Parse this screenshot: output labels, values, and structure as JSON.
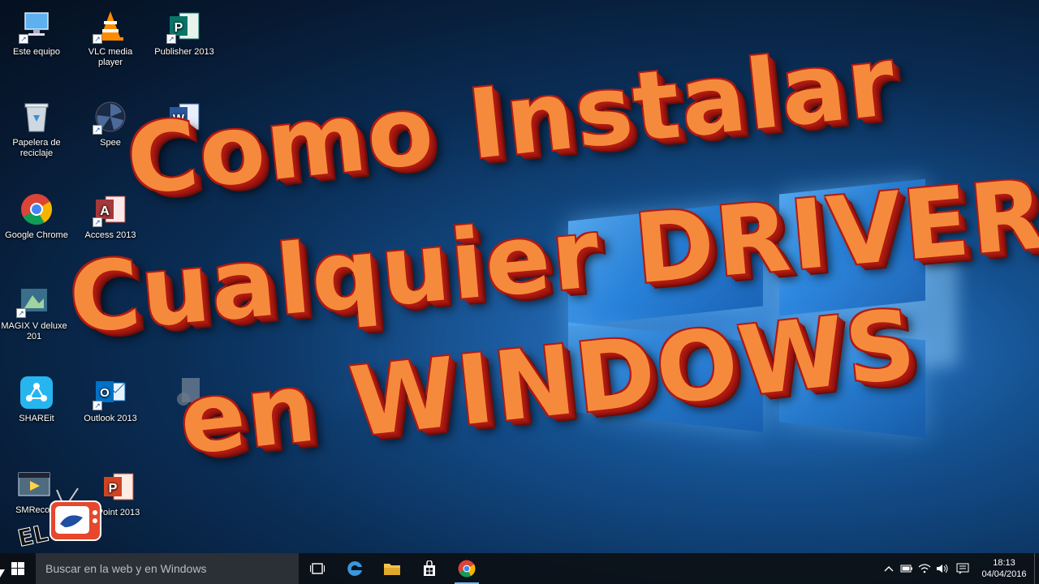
{
  "desktop": {
    "icons": [
      {
        "label": "Este equipo",
        "icon": "computer-icon"
      },
      {
        "label": "VLC media player",
        "icon": "vlc-icon"
      },
      {
        "label": "Publisher 2013",
        "icon": "publisher-icon"
      },
      {
        "label": "Papelera de reciclaje",
        "icon": "recycle-bin-icon"
      },
      {
        "label": "Spee",
        "icon": "speedfan-icon"
      },
      {
        "label": "",
        "icon": "word-icon"
      },
      {
        "label": "Google Chrome",
        "icon": "chrome-icon"
      },
      {
        "label": "Access 2013",
        "icon": "access-icon"
      },
      {
        "label": "MAGIX V deluxe 201",
        "icon": "magix-icon"
      },
      {
        "label": "SHAREit",
        "icon": "shareit-icon"
      },
      {
        "label": "Outlook 2013",
        "icon": "outlook-icon"
      },
      {
        "label": "SMRecor",
        "icon": "smrecorder-icon"
      },
      {
        "label": "Point 2013",
        "icon": "powerpoint-icon"
      }
    ]
  },
  "overlay": {
    "line1": "Como Instalar",
    "line2": "Cualquier DRIVER",
    "line3": "en WINDOWS"
  },
  "taskbar": {
    "search_placeholder": "Buscar en la web y en Windows",
    "time": "18:13",
    "date": "04/04/2016"
  },
  "colors": {
    "title_fill": "#f58a3c",
    "title_shadow": "#b01a10",
    "taskbar_bg": "#0c1016",
    "search_bg": "#2b2f36"
  }
}
